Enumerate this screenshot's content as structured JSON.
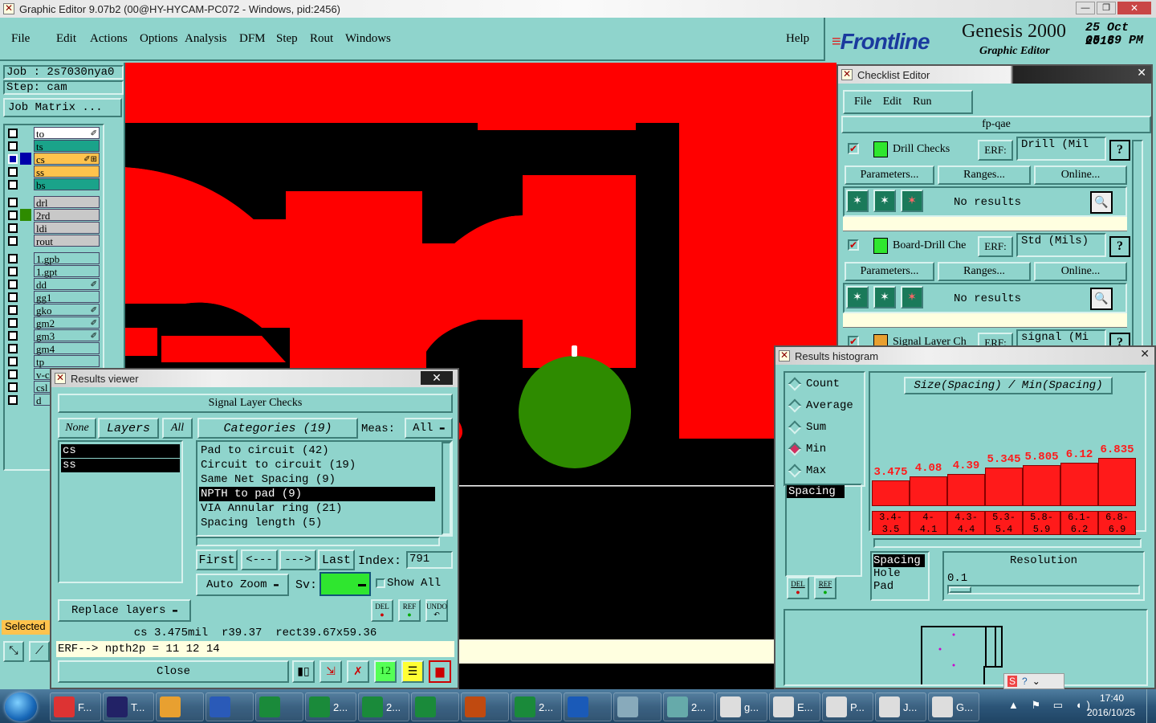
{
  "window_title": "Graphic Editor 9.07b2 (00@HY-HYCAM-PC072 - Windows, pid:2456)",
  "menu": [
    "File",
    "Edit",
    "Actions",
    "Options",
    "Analysis",
    "DFM",
    "Step",
    "Rout",
    "Windows"
  ],
  "help": "Help",
  "brand": {
    "logo": "Frontline",
    "product": "Genesis 2000",
    "subtitle": "Graphic Editor",
    "date": "25 Oct 2016",
    "time": "05:39 PM"
  },
  "job": {
    "job": "Job : 2s7030nya0",
    "step": "Step: cam",
    "matrix": "Job Matrix ..."
  },
  "layers": [
    {
      "name": "to",
      "color": "#ffffff",
      "mark": "✐"
    },
    {
      "name": "ts",
      "color": "#1aa38a",
      "mark": ""
    },
    {
      "name": "cs",
      "color": "#ffc34d",
      "mark": "✐⊞"
    },
    {
      "name": "ss",
      "color": "#ffc34d",
      "mark": ""
    },
    {
      "name": "bs",
      "color": "#1aa38a",
      "mark": ""
    },
    {
      "name": "drl",
      "color": "#c8c8c8",
      "mark": ""
    },
    {
      "name": "2rd",
      "color": "#c8c8c8",
      "mark": ""
    },
    {
      "name": "ldi",
      "color": "#c8c8c8",
      "mark": ""
    },
    {
      "name": "rout",
      "color": "#c8c8c8",
      "mark": ""
    },
    {
      "name": "1.gpb",
      "color": "#8fd4cc",
      "mark": ""
    },
    {
      "name": "1.gpt",
      "color": "#8fd4cc",
      "mark": ""
    },
    {
      "name": "dd",
      "color": "#8fd4cc",
      "mark": "✐"
    },
    {
      "name": "gg1",
      "color": "#8fd4cc",
      "mark": ""
    },
    {
      "name": "gko",
      "color": "#8fd4cc",
      "mark": "✐"
    },
    {
      "name": "gm2",
      "color": "#8fd4cc",
      "mark": "✐"
    },
    {
      "name": "gm3",
      "color": "#8fd4cc",
      "mark": "✐"
    },
    {
      "name": "gm4",
      "color": "#8fd4cc",
      "mark": ""
    },
    {
      "name": "tp",
      "color": "#8fd4cc",
      "mark": ""
    },
    {
      "name": "v-c",
      "color": "#8fd4cc",
      "mark": ""
    },
    {
      "name": "csl",
      "color": "#8fd4cc",
      "mark": ""
    },
    {
      "name": "d",
      "color": "#8fd4cc",
      "mark": ""
    }
  ],
  "selected_label": "Selected",
  "checklist": {
    "title": "Checklist Editor",
    "menu": [
      "File",
      "Edit",
      "Run"
    ],
    "name": "fp-qae",
    "checks": [
      {
        "name": "Drill Checks",
        "erf_label": "ERF:",
        "erf": "Drill (Mil",
        "results": "No results"
      },
      {
        "name": "Board-Drill Che",
        "erf_label": "ERF:",
        "erf": "Std (Mils)",
        "results": "No results"
      },
      {
        "name": "Signal Layer Ch",
        "erf_label": "ERF:",
        "erf": "signal (Mi",
        "results": ""
      }
    ],
    "buttons": {
      "params": "Parameters...",
      "ranges": "Ranges...",
      "online": "Online..."
    },
    "help_q": "?"
  },
  "results_viewer": {
    "title": "Results viewer",
    "header": "Signal Layer Checks",
    "none": "None",
    "layers": "Layers",
    "all": "All",
    "categories_btn": "Categories (19)",
    "meas_label": "Meas:",
    "meas_value": "All",
    "layer_list": [
      "cs",
      "ss"
    ],
    "categories": [
      "Pad to circuit (42)",
      "Circuit to circuit (19)",
      "Same Net Spacing (9)",
      "NPTH to pad (9)",
      "VIA Annular ring (21)",
      "Spacing length (5)"
    ],
    "selected_category": "NPTH to pad (9)",
    "nav": {
      "first": "First",
      "prev": "<---",
      "next": "--->",
      "last": "Last",
      "index_label": "Index:",
      "index": "791"
    },
    "auto_zoom": "Auto Zoom",
    "sv_label": "Sv:",
    "show_all": "Show All",
    "replace_layers": "Replace layers",
    "del": "DEL",
    "ref": "REF",
    "undo": "UNDO",
    "status": "cs 3.475mil  r39.37  rect39.67x59.36",
    "erf_line": "ERF--> npth2p = 11 12 14",
    "close": "Close"
  },
  "histogram": {
    "title": "Results histogram",
    "modes": [
      "Count",
      "Average",
      "Sum",
      "Min",
      "Max"
    ],
    "active_mode": "Min",
    "chart_title": "Size(Spacing) / Min(Spacing)",
    "list_selected": "Spacing",
    "size_options": [
      "Spacing",
      "Hole",
      "Pad"
    ],
    "resolution_label": "Resolution",
    "resolution": "0.1",
    "del": "DEL",
    "ref": "REF"
  },
  "chart_data": {
    "type": "bar",
    "categories": [
      "3.4-3.5",
      "4-4.1",
      "4.3-4.4",
      "5.3-5.4",
      "5.8-5.9",
      "6.1-6.2",
      "6.8-6.9"
    ],
    "values": [
      3.475,
      4.08,
      4.39,
      5.345,
      5.805,
      6.12,
      6.835
    ],
    "value_labels": [
      "3.475",
      "4.08",
      "4.39",
      "5.345",
      "5.805",
      "6.12",
      "6.835"
    ],
    "bin_labels_top": [
      "3.4-",
      "4-",
      "4.3-",
      "5.3-",
      "5.8-",
      "6.1-",
      "6.8-"
    ],
    "bin_labels_bottom": [
      "3.5",
      "4.1",
      "4.4",
      "5.4",
      "5.9",
      "6.2",
      "6.9"
    ],
    "title": "Size(Spacing) / Min(Spacing)",
    "bar_color": "#ff1a1a"
  },
  "taskbar": {
    "items": [
      "F...",
      "T...",
      "",
      "",
      "",
      "2...",
      "2...",
      "",
      "",
      "2...",
      "",
      "",
      "2...",
      "g...",
      "E...",
      "P...",
      "J...",
      "G...",
      "2..."
    ],
    "clock_time": "17:40",
    "clock_date": "2016/10/25"
  }
}
